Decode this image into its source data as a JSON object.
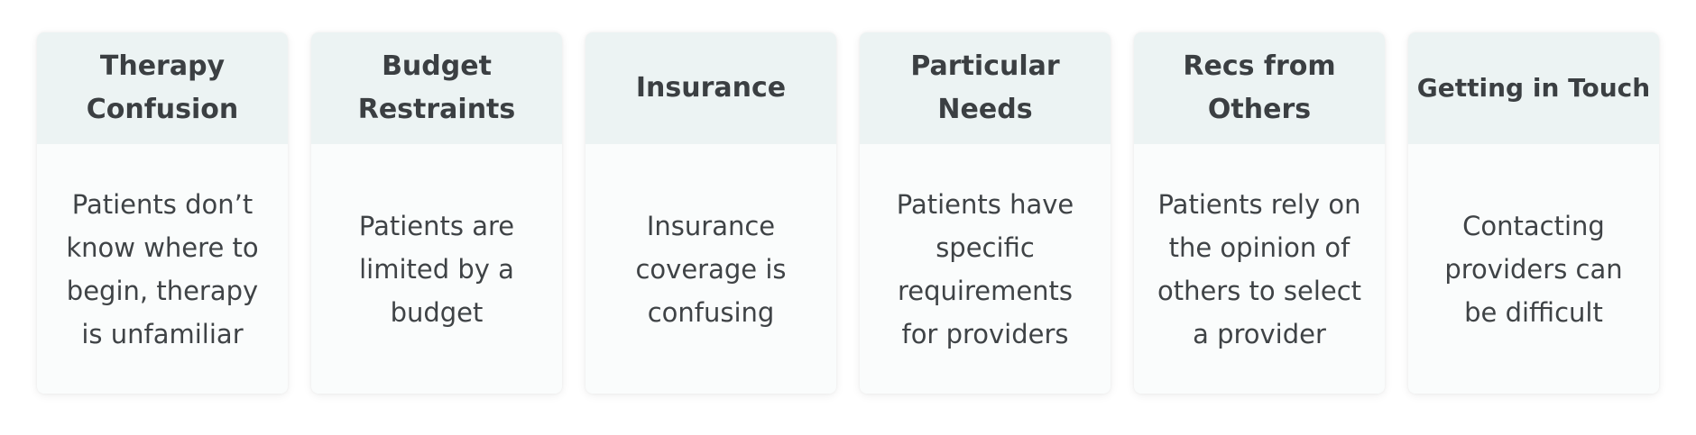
{
  "cards": [
    {
      "title": "Therapy Confusion",
      "body": "Patients don’t know where to begin, therapy is unfamiliar"
    },
    {
      "title": "Budget Restraints",
      "body": "Patients are limited by a budget"
    },
    {
      "title": "Insurance",
      "body": "Insurance coverage is confusing"
    },
    {
      "title": "Particular Needs",
      "body": "Patients have specific requirements for providers"
    },
    {
      "title": "Recs from Others",
      "body": "Patients rely on the opinion of others to select a provider"
    },
    {
      "title": "Getting in Touch",
      "body": "Contacting providers can be difficult"
    }
  ]
}
